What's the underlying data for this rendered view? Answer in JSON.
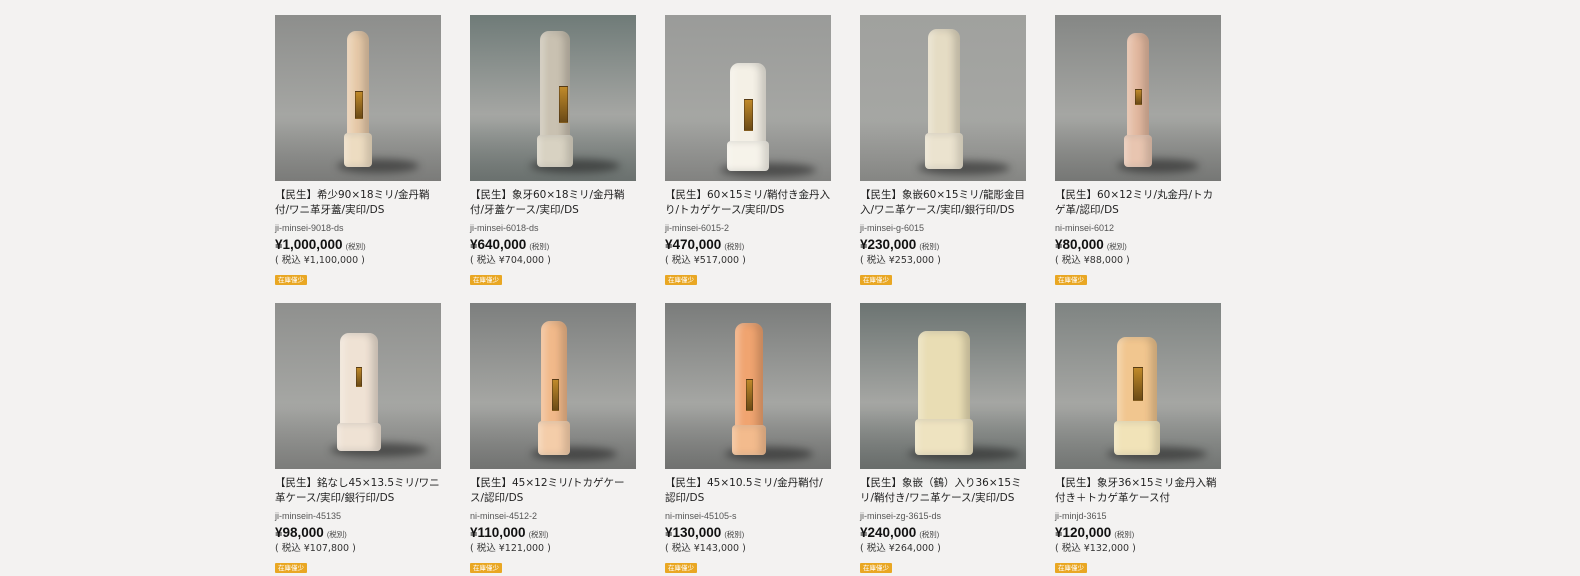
{
  "colors": {
    "background": "#f3f2f1",
    "badge": "#e9a723",
    "text": "#222222"
  },
  "labels": {
    "tax_excluded": "(税別)"
  },
  "products": [
    {
      "name": "【民生】希少90×18ミリ/金丹鞘付/ワニ革牙蓋/実印/DS",
      "code": "ji-minsei-9018-ds",
      "price": "¥1,000,000",
      "price_incl": "( 税込 ¥1,100,000 )",
      "badge": "在庫僅少",
      "image_icon": "ivory-stamp-icon",
      "stamp_color": "#e7caa9",
      "band_color": "#eddcc1",
      "bg_color": "#8d8e8c"
    },
    {
      "name": "【民生】象牙60×18ミリ/金丹鞘付/牙蓋ケース/実印/DS",
      "code": "ji-minsei-6018-ds",
      "price": "¥640,000",
      "price_incl": "( 税込 ¥704,000 )",
      "badge": "在庫僅少",
      "image_icon": "ivory-stamp-icon",
      "stamp_color": "#c9c1b1",
      "band_color": "#d8d2c2",
      "bg_color": "#6f7b78"
    },
    {
      "name": "【民生】60×15ミリ/鞘付き金丹入り/トカゲケース/実印/DS",
      "code": "ji-minsei-6015-2",
      "price": "¥470,000",
      "price_incl": "( 税込 ¥517,000 )",
      "badge": "在庫僅少",
      "image_icon": "ivory-stamp-icon",
      "stamp_color": "#f4f0e6",
      "band_color": "#f6f3ea",
      "bg_color": "#9a9b99"
    },
    {
      "name": "【民生】象嵌60×15ミリ/龍彫金目入/ワニ革ケース/実印/銀行印/DS",
      "code": "ji-minsei-g-6015",
      "price": "¥230,000",
      "price_incl": "( 税込 ¥253,000 )",
      "badge": "在庫僅少",
      "image_icon": "carved-dragon-stamp-icon",
      "stamp_color": "#e5dcc4",
      "band_color": "#ebe3cf",
      "bg_color": "#a0a19e"
    },
    {
      "name": "【民生】60×12ミリ/丸金丹/トカゲ革/認印/DS",
      "code": "ni-minsei-6012",
      "price": "¥80,000",
      "price_incl": "( 税込 ¥88,000 )",
      "badge": "在庫僅少",
      "image_icon": "ivory-stamp-icon",
      "stamp_color": "#e3b9a0",
      "band_color": "#e8c5b0",
      "bg_color": "#858785"
    },
    {
      "name": "【民生】銘なし45×13.5ミリ/ワニ革ケース/実印/銀行印/DS",
      "code": "ji-minsein-45135",
      "price": "¥98,000",
      "price_incl": "( 税込 ¥107,800 )",
      "badge": "在庫僅少",
      "image_icon": "ivory-stamp-icon",
      "stamp_color": "#efe2d4",
      "band_color": "#efe2d4",
      "bg_color": "#8f908e"
    },
    {
      "name": "【民生】45×12ミリ/トカゲケース/認印/DS",
      "code": "ni-minsei-4512-2",
      "price": "¥110,000",
      "price_incl": "( 税込 ¥121,000 )",
      "badge": "在庫僅少",
      "image_icon": "ivory-stamp-icon",
      "stamp_color": "#f1b98a",
      "band_color": "#f4cda9",
      "bg_color": "#7d7f7e"
    },
    {
      "name": "【民生】45×10.5ミリ/金丹鞘付/認印/DS",
      "code": "ni-minsei-45105-s",
      "price": "¥130,000",
      "price_incl": "( 税込 ¥143,000 )",
      "badge": "在庫僅少",
      "image_icon": "ivory-stamp-icon",
      "stamp_color": "#f0a470",
      "band_color": "#f3bb8d",
      "bg_color": "#7a7c7b"
    },
    {
      "name": "【民生】象嵌（鶴）入り36×15ミリ/鞘付き/ワニ革ケース/実印/DS",
      "code": "ji-minsei-zg-3615-ds",
      "price": "¥240,000",
      "price_incl": "( 税込 ¥264,000 )",
      "badge": "在庫僅少",
      "image_icon": "crane-inlay-stamp-icon",
      "stamp_color": "#e9ddb4",
      "band_color": "#eee3c0",
      "bg_color": "#6c7472"
    },
    {
      "name": "【民生】象牙36×15ミリ金丹入鞘付き＋トカゲ革ケース付",
      "code": "ji-minjd-3615",
      "price": "¥120,000",
      "price_incl": "( 税込 ¥132,000 )",
      "badge": "在庫僅少",
      "image_icon": "ivory-stamp-icon",
      "stamp_color": "#f1c68f",
      "band_color": "#f1e3b8",
      "bg_color": "#7f8482"
    }
  ]
}
